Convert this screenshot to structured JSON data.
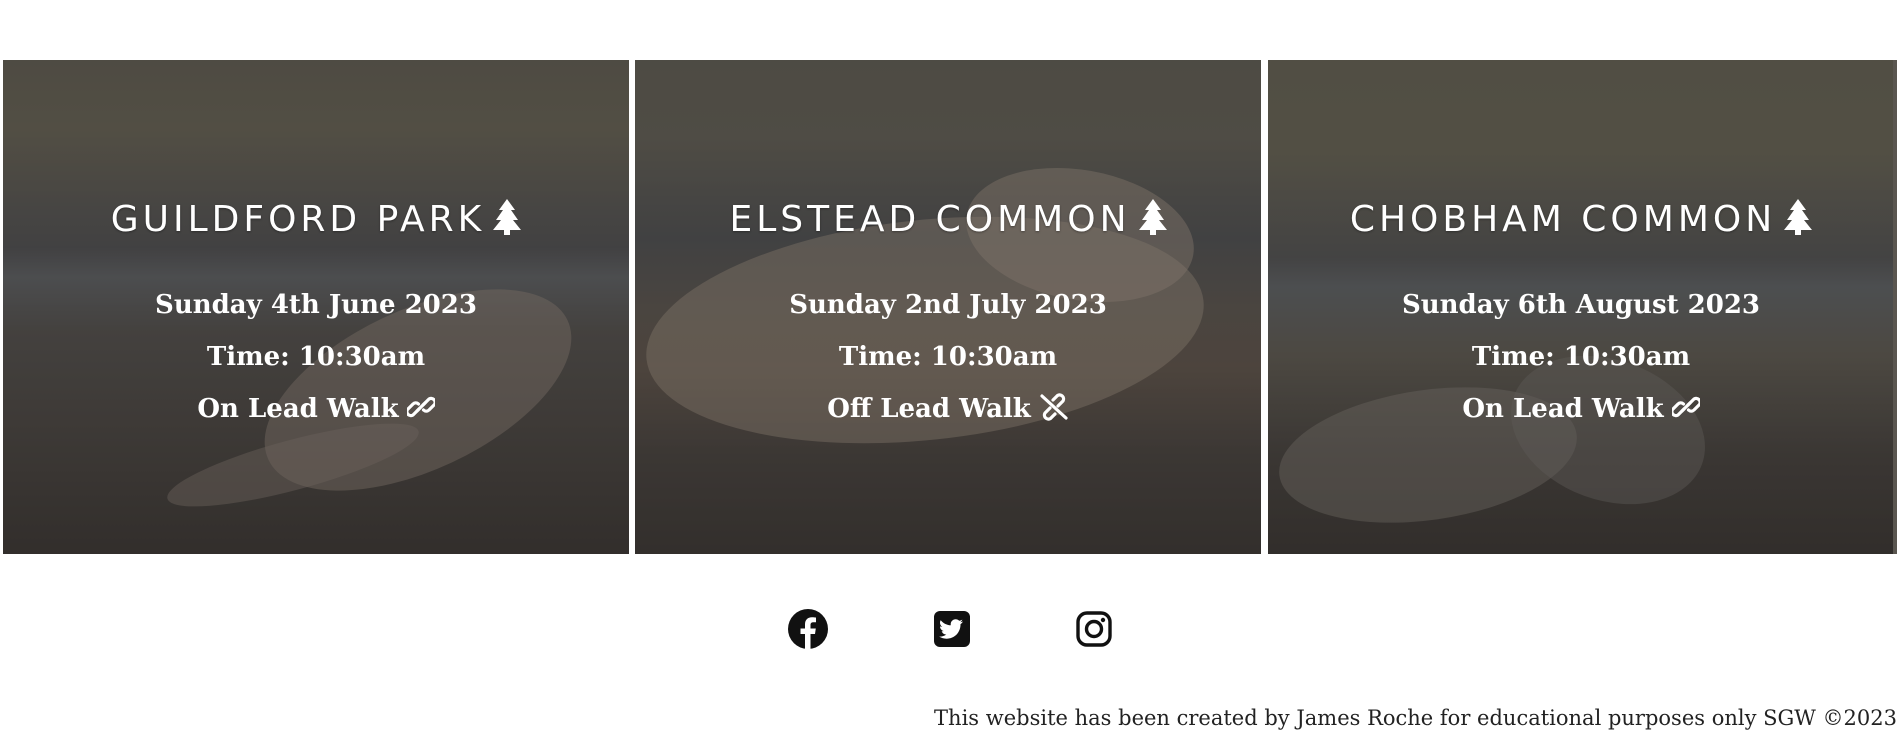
{
  "events": [
    {
      "title": "GUILDFORD PARK",
      "title_icon": "tree-icon",
      "date": "Sunday 4th June 2023",
      "time": "Time: 10:30am",
      "walk_type": "On Lead Walk",
      "walk_icon": "link-icon"
    },
    {
      "title": "ELSTEAD COMMON",
      "title_icon": "tree-icon",
      "date": "Sunday 2nd July 2023",
      "time": "Time: 10:30am",
      "walk_type": "Off Lead Walk",
      "walk_icon": "link-slash-icon"
    },
    {
      "title": "CHOBHAM COMMON",
      "title_icon": "tree-icon",
      "date": "Sunday 6th August 2023",
      "time": "Time: 10:30am",
      "walk_type": "On Lead Walk",
      "walk_icon": "link-icon"
    }
  ],
  "social": {
    "icons": [
      "facebook-icon",
      "twitter-icon",
      "instagram-icon"
    ]
  },
  "footer": {
    "text": "This website has been created by James Roche for educational purposes only SGW ©2023"
  },
  "colors": {
    "card_text": "#ffffff",
    "icon_color": "#111111",
    "footer_text": "#222222",
    "background": "#ffffff"
  }
}
